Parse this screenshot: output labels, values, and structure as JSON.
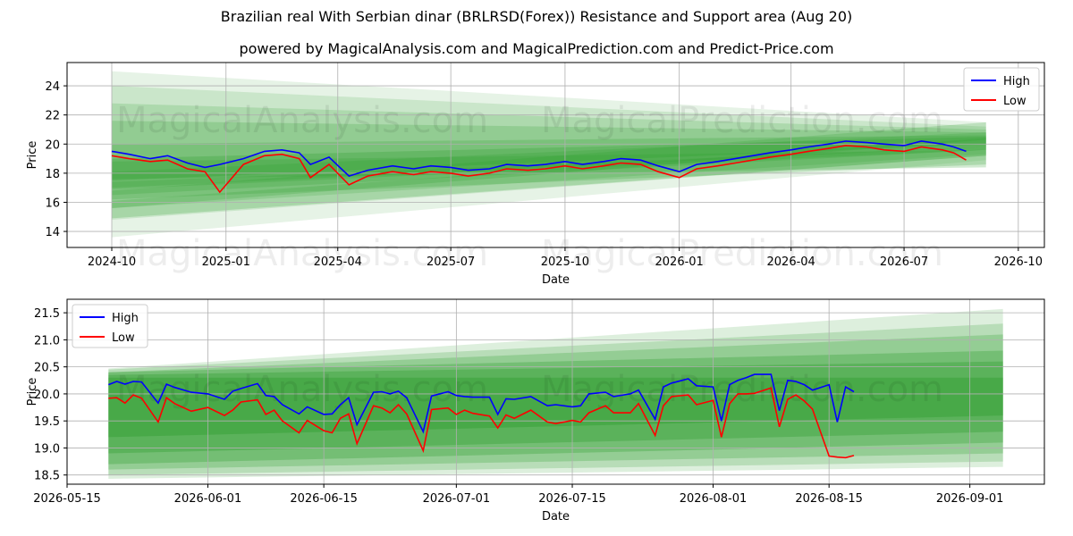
{
  "title": "Brazilian real With Serbian dinar (BRLRSD(Forex)) Resistance and Support area (Aug 20)",
  "subtitle": "powered by MagicalAnalysis.com and MagicalPrediction.com and Predict-Price.com",
  "watermarks": [
    "MagicalAnalysis.com",
    "MagicalPrediction.com"
  ],
  "colors": {
    "high": "#0000ff",
    "low": "#ff0000",
    "band": "#2e9e2e",
    "grid": "#b0b0b0"
  },
  "chart_data": [
    {
      "type": "line",
      "xlabel": "Date",
      "ylabel": "Price",
      "x_ticks": [
        "2024-10",
        "2025-01",
        "2025-04",
        "2025-07",
        "2025-10",
        "2026-01",
        "2026-04",
        "2026-07",
        "2026-10"
      ],
      "y_ticks": [
        "14",
        "16",
        "18",
        "20",
        "22",
        "24"
      ],
      "ylim": [
        12.9,
        25.6
      ],
      "xlim": [
        "2024-08-26",
        "2026-10-22"
      ],
      "grid": true,
      "legend": "top-right",
      "series": [
        {
          "name": "High",
          "x": [
            "2024-10-01",
            "2024-10-15",
            "2024-11-01",
            "2024-11-15",
            "2024-12-01",
            "2024-12-15",
            "2024-12-27",
            "2025-01-15",
            "2025-02-01",
            "2025-02-15",
            "2025-03-01",
            "2025-03-10",
            "2025-03-25",
            "2025-04-10",
            "2025-04-25",
            "2025-05-15",
            "2025-06-01",
            "2025-06-15",
            "2025-07-01",
            "2025-07-15",
            "2025-08-01",
            "2025-08-15",
            "2025-09-01",
            "2025-09-15",
            "2025-10-01",
            "2025-10-15",
            "2025-11-01",
            "2025-11-15",
            "2025-12-01",
            "2025-12-15",
            "2026-01-01",
            "2026-01-15",
            "2026-02-01",
            "2026-02-15",
            "2026-03-01",
            "2026-03-15",
            "2026-04-01",
            "2026-04-15",
            "2026-05-01",
            "2026-05-15",
            "2026-06-01",
            "2026-06-15",
            "2026-07-01",
            "2026-07-15",
            "2026-08-01",
            "2026-08-10",
            "2026-08-20"
          ],
          "values": [
            19.5,
            19.3,
            19.0,
            19.2,
            18.7,
            18.4,
            18.6,
            19.0,
            19.5,
            19.6,
            19.4,
            18.6,
            19.1,
            17.8,
            18.2,
            18.5,
            18.3,
            18.5,
            18.4,
            18.2,
            18.3,
            18.6,
            18.5,
            18.6,
            18.8,
            18.6,
            18.8,
            19.0,
            18.9,
            18.5,
            18.1,
            18.6,
            18.8,
            19.0,
            19.2,
            19.4,
            19.6,
            19.8,
            20.0,
            20.2,
            20.1,
            20.0,
            19.9,
            20.2,
            20.0,
            19.8,
            19.5
          ]
        },
        {
          "name": "Low",
          "x": [
            "2024-10-01",
            "2024-10-15",
            "2024-11-01",
            "2024-11-15",
            "2024-12-01",
            "2024-12-15",
            "2024-12-27",
            "2025-01-15",
            "2025-02-01",
            "2025-02-15",
            "2025-03-01",
            "2025-03-10",
            "2025-03-25",
            "2025-04-10",
            "2025-04-25",
            "2025-05-15",
            "2025-06-01",
            "2025-06-15",
            "2025-07-01",
            "2025-07-15",
            "2025-08-01",
            "2025-08-15",
            "2025-09-01",
            "2025-09-15",
            "2025-10-01",
            "2025-10-15",
            "2025-11-01",
            "2025-11-15",
            "2025-12-01",
            "2025-12-15",
            "2026-01-01",
            "2026-01-15",
            "2026-02-01",
            "2026-02-15",
            "2026-03-01",
            "2026-03-15",
            "2026-04-01",
            "2026-04-15",
            "2026-05-01",
            "2026-05-15",
            "2026-06-01",
            "2026-06-15",
            "2026-07-01",
            "2026-07-15",
            "2026-08-01",
            "2026-08-10",
            "2026-08-20"
          ],
          "values": [
            19.2,
            19.0,
            18.8,
            18.9,
            18.3,
            18.1,
            16.7,
            18.6,
            19.2,
            19.3,
            19.0,
            17.7,
            18.6,
            17.2,
            17.8,
            18.1,
            17.9,
            18.1,
            18.0,
            17.8,
            18.0,
            18.3,
            18.2,
            18.3,
            18.5,
            18.3,
            18.5,
            18.7,
            18.6,
            18.1,
            17.7,
            18.3,
            18.5,
            18.7,
            18.9,
            19.1,
            19.3,
            19.5,
            19.7,
            19.9,
            19.8,
            19.6,
            19.5,
            19.8,
            19.6,
            19.4,
            18.9
          ]
        }
      ]
    },
    {
      "type": "line",
      "xlabel": "Date",
      "ylabel": "Price",
      "x_ticks": [
        "2026-05-15",
        "2026-06-01",
        "2026-06-15",
        "2026-07-01",
        "2026-07-15",
        "2026-08-01",
        "2026-08-15",
        "2026-09-01"
      ],
      "y_ticks": [
        "18.5",
        "19.0",
        "19.5",
        "20.0",
        "20.5",
        "21.0",
        "21.5"
      ],
      "ylim": [
        18.33,
        21.75
      ],
      "xlim": [
        "2026-05-15",
        "2026-09-10"
      ],
      "grid": true,
      "legend": "top-left",
      "series": [
        {
          "name": "High",
          "x": [
            "2026-05-20",
            "2026-05-21",
            "2026-05-22",
            "2026-05-23",
            "2026-05-24",
            "2026-05-26",
            "2026-05-27",
            "2026-05-28",
            "2026-05-30",
            "2026-06-01",
            "2026-06-03",
            "2026-06-04",
            "2026-06-05",
            "2026-06-07",
            "2026-06-08",
            "2026-06-09",
            "2026-06-10",
            "2026-06-12",
            "2026-06-13",
            "2026-06-15",
            "2026-06-16",
            "2026-06-17",
            "2026-06-18",
            "2026-06-19",
            "2026-06-21",
            "2026-06-22",
            "2026-06-23",
            "2026-06-24",
            "2026-06-25",
            "2026-06-27",
            "2026-06-28",
            "2026-06-30",
            "2026-07-01",
            "2026-07-02",
            "2026-07-03",
            "2026-07-05",
            "2026-07-06",
            "2026-07-07",
            "2026-07-08",
            "2026-07-10",
            "2026-07-12",
            "2026-07-13",
            "2026-07-15",
            "2026-07-16",
            "2026-07-17",
            "2026-07-19",
            "2026-07-20",
            "2026-07-22",
            "2026-07-23",
            "2026-07-25",
            "2026-07-26",
            "2026-07-27",
            "2026-07-29",
            "2026-07-30",
            "2026-08-01",
            "2026-08-02",
            "2026-08-03",
            "2026-08-04",
            "2026-08-05",
            "2026-08-06",
            "2026-08-08",
            "2026-08-09",
            "2026-08-10",
            "2026-08-11",
            "2026-08-12",
            "2026-08-13",
            "2026-08-15",
            "2026-08-16",
            "2026-08-17",
            "2026-08-18"
          ],
          "values": [
            20.17,
            20.23,
            20.18,
            20.23,
            20.22,
            19.83,
            20.18,
            20.12,
            20.03,
            20.0,
            19.9,
            20.05,
            20.1,
            20.19,
            19.97,
            19.95,
            19.8,
            19.63,
            19.76,
            19.62,
            19.63,
            19.8,
            19.93,
            19.43,
            20.03,
            20.04,
            20.0,
            20.05,
            19.93,
            19.3,
            19.96,
            20.04,
            19.97,
            19.95,
            19.94,
            19.94,
            19.62,
            19.91,
            19.9,
            19.95,
            19.78,
            19.8,
            19.76,
            19.78,
            20.0,
            20.03,
            19.95,
            20.0,
            20.07,
            19.53,
            20.13,
            20.2,
            20.28,
            20.15,
            20.13,
            19.5,
            20.17,
            20.25,
            20.3,
            20.36,
            20.36,
            19.69,
            20.25,
            20.23,
            20.17,
            20.07,
            20.17,
            19.48,
            20.13,
            20.04
          ],
          "keep": true
        }
      ]
    }
  ]
}
